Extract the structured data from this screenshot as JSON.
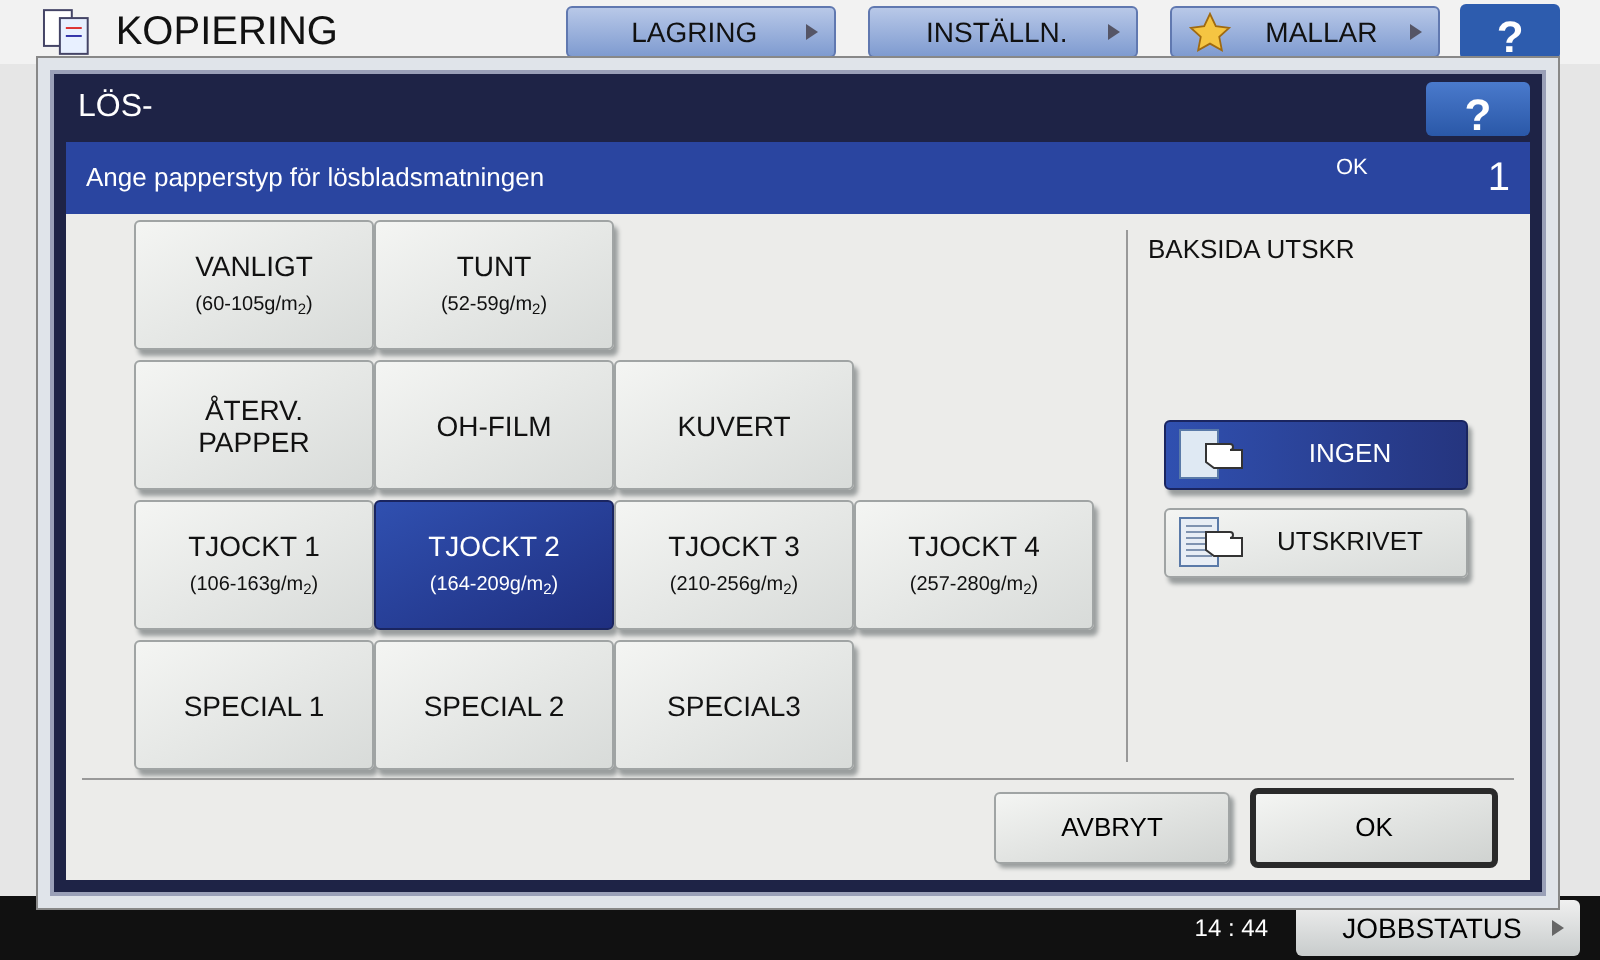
{
  "app": {
    "title": "KOPIERING",
    "tabs": [
      {
        "label": "LAGRING",
        "kind": "plain"
      },
      {
        "label": "INSTÄLLN.",
        "kind": "plain"
      },
      {
        "label": "MALLAR",
        "kind": "star"
      }
    ],
    "help": "?",
    "time": "14 : 44",
    "job_status": "JOBBSTATUS"
  },
  "dialog": {
    "title": "LÖS-",
    "help": "?",
    "instruction": "Ange papperstyp för lösbladsmatningen",
    "status": "OK",
    "count": "1",
    "paper_rows": [
      [
        {
          "label": "VANLIGT",
          "weight": "(60-105g/m$_{2}$)",
          "selected": false
        },
        {
          "label": "TUNT",
          "weight": "(52-59g/m$_{2}$)",
          "selected": false
        }
      ],
      [
        {
          "label": "ÅTERV.\nPAPPER",
          "selected": false
        },
        {
          "label": "OH-FILM",
          "selected": false
        },
        {
          "label": "KUVERT",
          "selected": false
        }
      ],
      [
        {
          "label": "TJOCKT 1",
          "weight": "(106-163g/m$_{2}$)",
          "selected": false
        },
        {
          "label": "TJOCKT 2",
          "weight": "(164-209g/m$_{2}$)",
          "selected": true
        },
        {
          "label": "TJOCKT 3",
          "weight": "(210-256g/m$_{2}$)",
          "selected": false
        },
        {
          "label": "TJOCKT 4",
          "weight": "(257-280g/m$_{2}$)",
          "selected": false
        }
      ],
      [
        {
          "label": "SPECIAL 1",
          "selected": false
        },
        {
          "label": "SPECIAL 2",
          "selected": false
        },
        {
          "label": "SPECIAL3",
          "selected": false
        }
      ]
    ],
    "back_print": {
      "label": "BAKSIDA UTSKR",
      "options": [
        {
          "label": "INGEN",
          "kind": "blank",
          "selected": true
        },
        {
          "label": "UTSKRIVET",
          "kind": "printed",
          "selected": false
        }
      ]
    },
    "cancel": "AVBRYT",
    "ok": "OK"
  }
}
